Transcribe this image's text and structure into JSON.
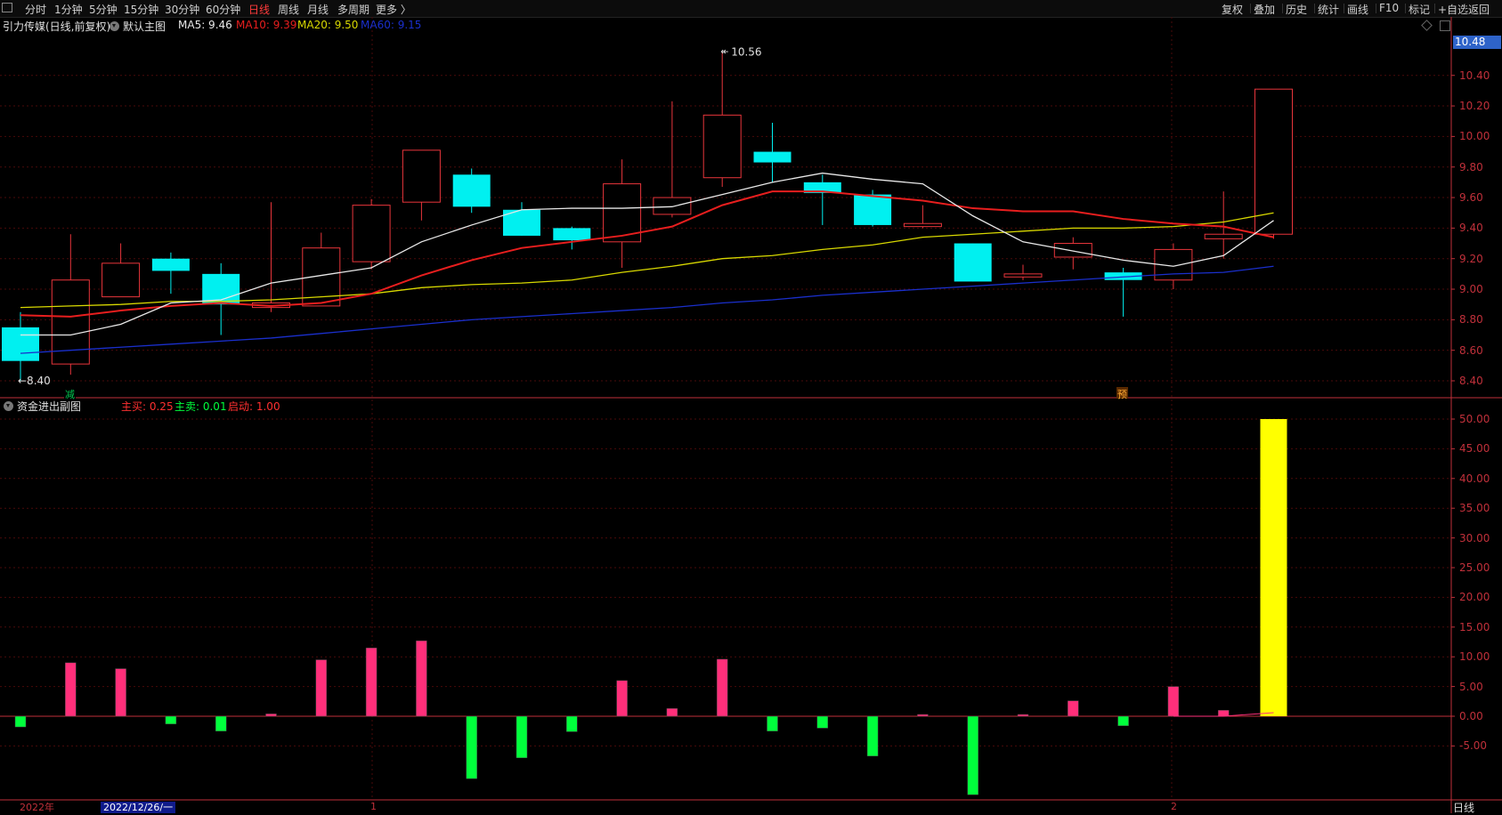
{
  "toolbar": {
    "left": [
      {
        "label": "分时"
      },
      {
        "label": "1分钟"
      },
      {
        "label": "5分钟"
      },
      {
        "label": "15分钟"
      },
      {
        "label": "30分钟"
      },
      {
        "label": "60分钟"
      },
      {
        "label": "日线",
        "active": true
      },
      {
        "label": "周线"
      },
      {
        "label": "月线"
      },
      {
        "label": "多周期"
      },
      {
        "label": "更多 〉"
      }
    ],
    "right": [
      {
        "label": "复权"
      },
      {
        "label": "叠加"
      },
      {
        "label": "历史"
      },
      {
        "label": "统计"
      },
      {
        "label": "画线"
      },
      {
        "label": "F10"
      },
      {
        "label": "标记"
      },
      {
        "label": "+自选"
      },
      {
        "label": "返回"
      }
    ]
  },
  "main_info": {
    "stock": "引力传媒(日线,前复权)",
    "indicator": "默认主图",
    "ma5": "MA5: 9.46",
    "ma10": "MA10: 9.39",
    "ma20": "MA20: 9.50",
    "ma60": "MA60: 9.15"
  },
  "sub_info": {
    "title": "资金进出副图",
    "buy": "主买: 0.25",
    "sell": "主卖: 0.01",
    "start": "启动: 1.00"
  },
  "colors": {
    "up": "#e8353b",
    "down": "#00f0f0",
    "ma5": "#e8e8e8",
    "ma10": "#e81e1e",
    "ma20": "#d8d800",
    "ma60": "#1a2fcc",
    "buy": "#ff2f7a",
    "sell": "#00ff3c",
    "start": "#ffff00",
    "axis": "#c0303a",
    "grid": "#4a0a0a"
  },
  "price_tag": "10.48",
  "annotations": {
    "high": "10.56",
    "low": "8.40",
    "tag_reduce": "减",
    "tag_pre": "预"
  },
  "footer": {
    "year": "2022年",
    "date": "2022/12/26/一",
    "period": "日线",
    "m1": "1",
    "m2": "2"
  },
  "chart_data": [
    {
      "type": "candlestick",
      "y_ticks": [
        "10.40",
        "10.20",
        "10.00",
        "9.80",
        "9.60",
        "9.40",
        "9.20",
        "9.00",
        "8.80",
        "8.60",
        "8.40"
      ],
      "ylim": [
        8.33,
        10.62
      ],
      "candles": [
        {
          "o": 8.75,
          "c": 8.53,
          "h": 8.85,
          "l": 8.4
        },
        {
          "o": 8.51,
          "c": 9.06,
          "h": 9.36,
          "l": 8.44
        },
        {
          "o": 8.95,
          "c": 9.17,
          "h": 9.3,
          "l": 8.95
        },
        {
          "o": 9.2,
          "c": 9.12,
          "h": 9.24,
          "l": 8.97
        },
        {
          "o": 9.1,
          "c": 8.9,
          "h": 9.17,
          "l": 8.7
        },
        {
          "o": 8.88,
          "c": 8.91,
          "h": 9.57,
          "l": 8.85
        },
        {
          "o": 8.89,
          "c": 9.27,
          "h": 9.37,
          "l": 8.89
        },
        {
          "o": 9.18,
          "c": 9.55,
          "h": 9.59,
          "l": 9.13
        },
        {
          "o": 9.57,
          "c": 9.91,
          "h": 9.91,
          "l": 9.45
        },
        {
          "o": 9.75,
          "c": 9.54,
          "h": 9.79,
          "l": 9.5
        },
        {
          "o": 9.52,
          "c": 9.35,
          "h": 9.57,
          "l": 9.35
        },
        {
          "o": 9.4,
          "c": 9.32,
          "h": 9.41,
          "l": 9.26
        },
        {
          "o": 9.31,
          "c": 9.69,
          "h": 9.85,
          "l": 9.14
        },
        {
          "o": 9.49,
          "c": 9.6,
          "h": 10.23,
          "l": 9.47
        },
        {
          "o": 9.73,
          "c": 10.14,
          "h": 10.56,
          "l": 9.67
        },
        {
          "o": 9.9,
          "c": 9.83,
          "h": 10.09,
          "l": 9.7
        },
        {
          "o": 9.7,
          "c": 9.63,
          "h": 9.75,
          "l": 9.42
        },
        {
          "o": 9.62,
          "c": 9.42,
          "h": 9.65,
          "l": 9.41
        },
        {
          "o": 9.41,
          "c": 9.43,
          "h": 9.55,
          "l": 9.4
        },
        {
          "o": 9.3,
          "c": 9.05,
          "h": 9.3,
          "l": 9.05
        },
        {
          "o": 9.08,
          "c": 9.1,
          "h": 9.16,
          "l": 9.06
        },
        {
          "o": 9.21,
          "c": 9.3,
          "h": 9.34,
          "l": 9.13
        },
        {
          "o": 9.11,
          "c": 9.06,
          "h": 9.14,
          "l": 8.82
        },
        {
          "o": 9.06,
          "c": 9.26,
          "h": 9.3,
          "l": 9.0
        },
        {
          "o": 9.33,
          "c": 9.36,
          "h": 9.64,
          "l": 9.2
        },
        {
          "o": 9.36,
          "c": 10.31,
          "h": 10.31,
          "l": 9.33
        }
      ],
      "ma5": [
        8.7,
        8.7,
        8.77,
        8.91,
        8.93,
        9.04,
        9.09,
        9.14,
        9.31,
        9.42,
        9.52,
        9.53,
        9.53,
        9.54,
        9.62,
        9.7,
        9.76,
        9.72,
        9.69,
        9.48,
        9.31,
        9.25,
        9.19,
        9.15,
        9.22,
        9.45
      ],
      "ma10": [
        8.83,
        8.82,
        8.86,
        8.89,
        8.91,
        8.89,
        8.91,
        8.97,
        9.09,
        9.19,
        9.27,
        9.31,
        9.35,
        9.41,
        9.55,
        9.64,
        9.64,
        9.61,
        9.58,
        9.53,
        9.51,
        9.51,
        9.46,
        9.43,
        9.41,
        9.34,
        9.39
      ],
      "ma20": [
        8.88,
        8.89,
        8.9,
        8.92,
        8.92,
        8.93,
        8.95,
        8.97,
        9.01,
        9.03,
        9.04,
        9.06,
        9.11,
        9.15,
        9.2,
        9.22,
        9.26,
        9.29,
        9.34,
        9.36,
        9.38,
        9.4,
        9.4,
        9.41,
        9.44,
        9.5
      ],
      "ma60": [
        8.58,
        8.6,
        8.62,
        8.64,
        8.66,
        8.68,
        8.71,
        8.74,
        8.77,
        8.8,
        8.82,
        8.84,
        8.86,
        8.88,
        8.91,
        8.93,
        8.96,
        8.98,
        9.0,
        9.02,
        9.04,
        9.06,
        9.08,
        9.1,
        9.11,
        9.15
      ]
    },
    {
      "type": "bar",
      "y_ticks": [
        "50.00",
        "45.00",
        "40.00",
        "35.00",
        "30.00",
        "25.00",
        "20.00",
        "15.00",
        "10.00",
        "5.00",
        "0.00",
        "-5.00"
      ],
      "ylim": [
        -13.5,
        51.6
      ],
      "values": [
        -1.8,
        9.0,
        8.0,
        -1.3,
        -2.5,
        0.4,
        9.5,
        11.5,
        12.7,
        -10.5,
        -7.0,
        -2.6,
        6.0,
        1.3,
        9.6,
        -2.5,
        -2.0,
        -6.7,
        0.3,
        -13.2,
        0.3,
        2.6,
        -1.6,
        5.0,
        1.0,
        0.5
      ],
      "line": [
        0.0,
        0.0,
        0.0,
        0.0,
        0.0,
        0.0,
        0.0,
        0.0,
        0.0,
        0.0,
        0.0,
        0.0,
        0.0,
        0.0,
        0.0,
        0.0,
        0.0,
        0.0,
        0.0,
        0.0,
        0.0,
        0.0,
        0.0,
        0.0,
        0.0,
        0.6
      ],
      "start_value": 50.0
    }
  ]
}
